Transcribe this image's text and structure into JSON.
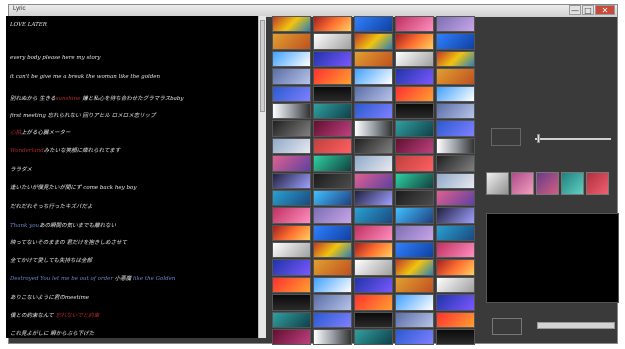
{
  "window": {
    "title": "Lyric",
    "buttons": {
      "minimize": "—",
      "maximize": "□",
      "close": "✕"
    }
  },
  "lyrics": {
    "lines": [
      {
        "parts": [
          {
            "text": "LOVE LATER",
            "tone": "normal"
          }
        ]
      },
      {
        "parts": [
          {
            "text": "every body please here my story",
            "tone": "normal"
          }
        ]
      },
      {
        "parts": [
          {
            "text": "it can't be give me a break the woman like the golden",
            "tone": "normal"
          }
        ]
      },
      {
        "parts": [
          {
            "text": "別れぬから 生きる",
            "tone": "normal"
          },
          {
            "text": "sunshine",
            "tone": "red"
          },
          {
            "text": "   嫌と私心を待ち合わせたグラマラスbaby",
            "tone": "normal"
          }
        ]
      },
      {
        "parts": [
          {
            "text": "first meeting 忘れられない 回りアヒル ロメロメ恋リップ",
            "tone": "normal"
          }
        ]
      },
      {
        "parts": [
          {
            "text": "心拍",
            "tone": "red"
          },
          {
            "text": "上がる心臓メーター",
            "tone": "normal"
          }
        ]
      },
      {
        "parts": [
          {
            "text": "Wonderland",
            "tone": "red"
          },
          {
            "text": "みたいな笑顔に痺れられてます",
            "tone": "normal"
          }
        ]
      },
      {
        "parts": [
          {
            "text": "ララダメ",
            "tone": "normal"
          }
        ]
      },
      {
        "parts": [
          {
            "text": "逢いたいが僕見たいが間にず come back hey boy",
            "tone": "normal"
          }
        ]
      },
      {
        "parts": [
          {
            "text": "だれだれそっち行ったキズバだよ",
            "tone": "normal"
          }
        ]
      },
      {
        "parts": [
          {
            "text": "Thank you",
            "tone": "blue"
          },
          {
            "text": "あの瞬間の気いまでも離れない",
            "tone": "normal"
          }
        ]
      },
      {
        "parts": [
          {
            "text": "映ってないそのままの  君だけを抱きしめさせて",
            "tone": "normal"
          }
        ]
      },
      {
        "parts": [
          {
            "text": "全てかけて愛しても失持ちは全部",
            "tone": "normal"
          }
        ]
      },
      {
        "parts": [
          {
            "text": "Destroyed You let me be out of order",
            "tone": "blue"
          },
          {
            "text": " 小悪魔 ",
            "tone": "normal"
          },
          {
            "text": "like the Golden",
            "tone": "blue"
          }
        ]
      },
      {
        "parts": [
          {
            "text": "ありこないように君のmeetime",
            "tone": "normal"
          }
        ]
      },
      {
        "parts": [
          {
            "text": "僕との約束なんて",
            "tone": "normal"
          },
          {
            "text": "  忘れないでと約束",
            "tone": "red"
          }
        ]
      },
      {
        "parts": [
          {
            "text": "これ見よがしに 瞬からぶら下げた",
            "tone": "normal"
          }
        ]
      }
    ]
  },
  "thumbnails": {
    "count": 95,
    "palette": [
      "linear-gradient(135deg,#c0392b,#f1c40f,#2980b9)",
      "linear-gradient(180deg,#0b0b0b,#2a2a2a)",
      "linear-gradient(135deg,#8fa9c9,#e9e9f0)",
      "linear-gradient(135deg,#7d6fb4,#c8a6e8)",
      "linear-gradient(135deg,#2034a8,#7b58ff)",
      "linear-gradient(90deg,#ffffff,#9aa0a6,#333)",
      "linear-gradient(135deg,#1b1b1b,#4d4d4d)",
      "linear-gradient(135deg,#a02020,#ff7030,#ffd060)",
      "linear-gradient(135deg,#5a6ea8,#b8c4e8)",
      "linear-gradient(135deg,#c04040,#ff6060)",
      "linear-gradient(135deg,#2aa0d0,#1a4a80)",
      "linear-gradient(135deg,#e0a030,#c05020)",
      "linear-gradient(135deg,#30a0a0,#10404a)",
      "linear-gradient(135deg,#e06090,#6040a0)",
      "linear-gradient(135deg,#3080ff,#1040a0)",
      "linear-gradient(135deg,#ff3030,#ffa030)",
      "linear-gradient(135deg,#202020,#808080)",
      "linear-gradient(135deg,#40c0ff,#204080)",
      "linear-gradient(135deg,#ffffff,#a0a0a0)",
      "linear-gradient(135deg,#2a5ad0,#8080ff)",
      "linear-gradient(135deg,#30d0a0,#104040)",
      "linear-gradient(135deg,#c03060,#ff90c0)",
      "linear-gradient(135deg,#40a0ff,#ffffff)",
      "linear-gradient(135deg,#601030,#c04080)",
      "linear-gradient(135deg,#202040,#a0a0ff)"
    ]
  },
  "right_panel": {
    "swatch_colors": [
      "linear-gradient(135deg,#f0f0f0,#909090)",
      "linear-gradient(135deg,#b04a8a,#f0a0c0)",
      "linear-gradient(135deg,#6a3a8a,#d06080)",
      "linear-gradient(135deg,#208080,#60d0c0)",
      "linear-gradient(135deg,#b03040,#f06070)"
    ]
  },
  "colors": {
    "window_bg": "#3a3a3a",
    "lyrics_bg": "#000000",
    "lyric_text": "#e8e8e8",
    "lyric_red": "#b22a2a",
    "lyric_blue": "#6d84c8"
  }
}
